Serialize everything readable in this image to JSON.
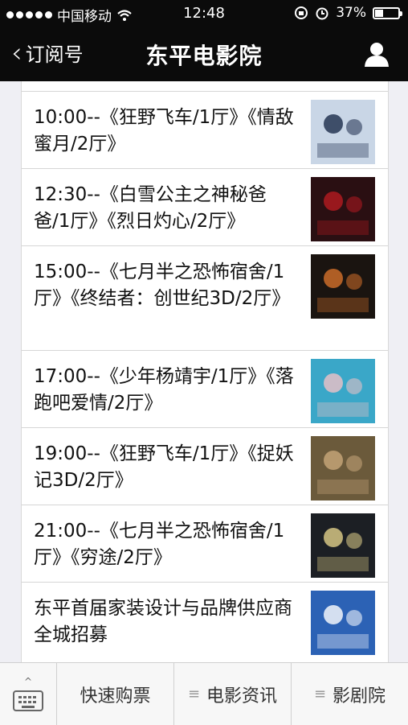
{
  "status": {
    "carrier": "中国移动",
    "time": "12:48",
    "battery": "37%",
    "battery_level": 0.37,
    "icons": [
      "signal-dots-icon",
      "wifi-icon",
      "rotation-lock-icon",
      "alarm-icon",
      "battery-icon"
    ]
  },
  "nav": {
    "back_label": "订阅号",
    "title": "东平电影院",
    "profile_icon": "person-icon"
  },
  "schedule": [
    {
      "text": "10:00--《狂野飞车/1厅》《情敌蜜月/2厅》",
      "thumb_color": "#c9d6e6",
      "accent": "#1b2c4a"
    },
    {
      "text": "12:30--《白雪公主之神秘爸爸/1厅》《烈日灼心/2厅》",
      "thumb_color": "#2a0f12",
      "accent": "#b51a20"
    },
    {
      "text": "15:00--《七月半之恐怖宿舍/1厅》《终结者：创世纪3D/2厅》",
      "thumb_color": "#1a1410",
      "accent": "#d5702a"
    },
    {
      "text": "17:00--《少年杨靖宇/1厅》《落跑吧爱情/2厅》",
      "thumb_color": "#3aa7c8",
      "accent": "#f0c2c7"
    },
    {
      "text": "19:00--《狂野飞车/1厅》《捉妖记3D/2厅》",
      "thumb_color": "#6b5a3b",
      "accent": "#c9a77b"
    },
    {
      "text": "21:00--《七月半之恐怖宿舍/1厅》《穷途/2厅》",
      "thumb_color": "#1c1f24",
      "accent": "#e1d08a"
    },
    {
      "text": "东平首届家装设计与品牌供应商全城招募",
      "thumb_color": "#2c62b5",
      "accent": "#ffffff"
    }
  ],
  "tabs": {
    "keyboard_icon": "keyboard-icon",
    "quick_buy": "快速购票",
    "movie_news": "电影资讯",
    "theater": "影剧院",
    "menu_icon": "≡"
  }
}
